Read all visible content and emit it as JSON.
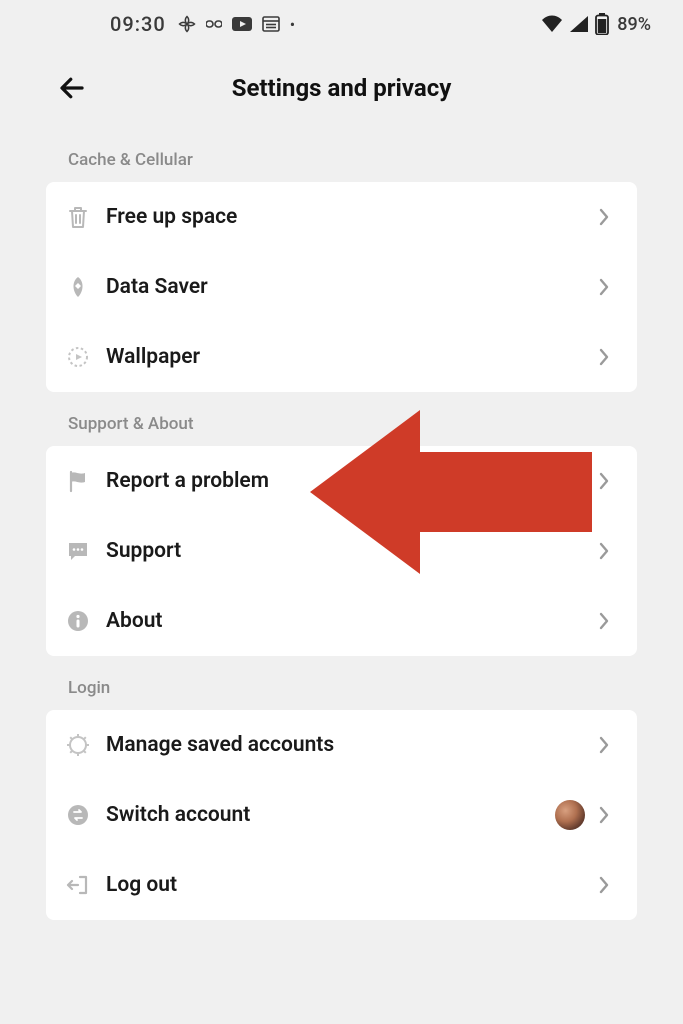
{
  "statusbar": {
    "time": "09:30",
    "battery_text": "89%"
  },
  "header": {
    "title": "Settings and privacy"
  },
  "sections": {
    "cache": {
      "label": "Cache & Cellular",
      "items": {
        "free_up_space": "Free up space",
        "data_saver": "Data Saver",
        "wallpaper": "Wallpaper"
      }
    },
    "support": {
      "label": "Support & About",
      "items": {
        "report_problem": "Report a problem",
        "support": "Support",
        "about": "About"
      }
    },
    "login": {
      "label": "Login",
      "items": {
        "manage_accounts": "Manage saved accounts",
        "switch_account": "Switch account",
        "log_out": "Log out"
      }
    }
  }
}
